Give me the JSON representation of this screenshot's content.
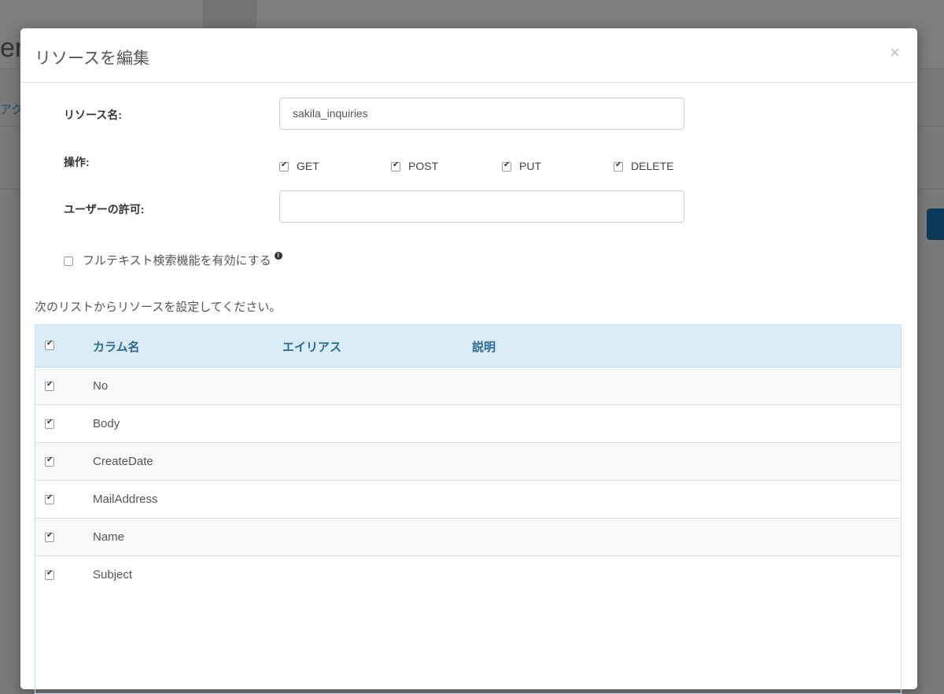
{
  "background": {
    "logo_fragment": "er",
    "link_fragment": "アクシ"
  },
  "modal": {
    "title": "リソースを編集",
    "close": "×",
    "resource_name_label": "リソース名:",
    "resource_name_value": "sakila_inquiries",
    "operations_label": "操作:",
    "operations": [
      {
        "label": "GET",
        "checked": true
      },
      {
        "label": "POST",
        "checked": true
      },
      {
        "label": "PUT",
        "checked": true
      },
      {
        "label": "DELETE",
        "checked": true
      }
    ],
    "user_permission_label": "ユーザーの許可:",
    "user_permission_value": "",
    "fulltext_label": "フルテキスト検索機能を有効にする",
    "fulltext_info": "i",
    "hint": "次のリストからリソースを設定してください。",
    "table": {
      "headers": [
        "カラム名",
        "エイリアス",
        "説明"
      ],
      "rows": [
        {
          "name": "No",
          "alias": "",
          "desc": ""
        },
        {
          "name": "Body",
          "alias": "",
          "desc": ""
        },
        {
          "name": "CreateDate",
          "alias": "",
          "desc": ""
        },
        {
          "name": "MailAddress",
          "alias": "",
          "desc": ""
        },
        {
          "name": "Name",
          "alias": "",
          "desc": ""
        },
        {
          "name": "Subject",
          "alias": "",
          "desc": ""
        }
      ]
    }
  }
}
